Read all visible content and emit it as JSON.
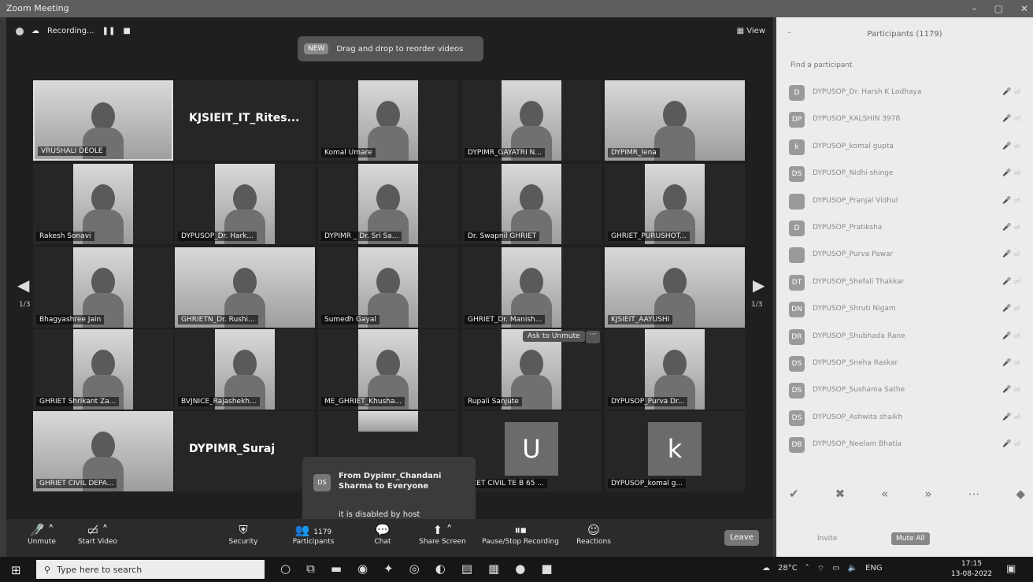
{
  "window": {
    "title": "Zoom Meeting",
    "controls": [
      "–",
      "▢",
      "✕"
    ]
  },
  "top_bar": {
    "recording_label": "Recording...",
    "view_label": "View"
  },
  "banner": {
    "badge": "NEW",
    "text": "Drag and drop to reorder videos"
  },
  "pager": {
    "left_count": "1/3",
    "right_count": "1/3"
  },
  "tiles": [
    {
      "label": "VRUSHALI DEOLE",
      "type": "wide"
    },
    {
      "label": "KJSIEIT_IT_Rites...",
      "type": "name"
    },
    {
      "label": "Komal Umare",
      "type": "narrow"
    },
    {
      "label": "DYPIMR_GAYATRI N...",
      "type": "narrow"
    },
    {
      "label": "DYPIMR_lena",
      "type": "wide"
    },
    {
      "label": "Rakesh Sonavi",
      "type": "narrow"
    },
    {
      "label": "DYPUSOP_Dr. Hark...",
      "type": "narrow"
    },
    {
      "label": "DYPIMR _ Dr. Sri Sa...",
      "type": "narrow"
    },
    {
      "label": "Dr. Swapnil GHRIET",
      "type": "narrow"
    },
    {
      "label": "GHRIET_PURUSHOT...",
      "type": "narrow"
    },
    {
      "label": "Bhagyashree Jain",
      "type": "narrow"
    },
    {
      "label": "GHRIETN_Dr. Rushi...",
      "type": "wide"
    },
    {
      "label": "Sumedh Gayal",
      "type": "narrow"
    },
    {
      "label": "GHRIET_Dr. Manish...",
      "type": "narrow"
    },
    {
      "label": "KJSIEIT_AAYUSHI",
      "type": "wide"
    },
    {
      "label": "GHRIET Shrikant Za...",
      "type": "narrow"
    },
    {
      "label": "BVJNICE_Rajashekh...",
      "type": "narrow"
    },
    {
      "label": "ME_GHRIET_Khusha...",
      "type": "narrow"
    },
    {
      "label": "Rupali Sanjute",
      "type": "narrow"
    },
    {
      "label": "DYPUSOP_Purva Dr...",
      "type": "narrow"
    },
    {
      "label": "GHRIET CIVIL DEPA...",
      "type": "wide"
    },
    {
      "label": "DYPIMR_Suraj",
      "type": "name"
    },
    {
      "label": "",
      "type": "partial"
    },
    {
      "label": "TCET CIVIL TE B 65 ...",
      "type": "avatar",
      "letter": "U"
    },
    {
      "label": "DYPUSOP_komal g...",
      "type": "avatar",
      "letter": "k"
    }
  ],
  "ask_to_unmute": {
    "label": "Ask to Unmute",
    "more": "···"
  },
  "chat_popup": {
    "avatar": "DS",
    "from": "From Dypimr_Chandani Sharma to Everyone",
    "message": "it is disabled by host"
  },
  "toolbar": {
    "unmute": "Unmute",
    "start_video": "Start Video",
    "security": "Security",
    "participants": "Participants",
    "participants_count": "1179",
    "chat": "Chat",
    "share_screen": "Share Screen",
    "pause_stop_recording": "Pause/Stop Recording",
    "reactions": "Reactions",
    "leave": "Leave"
  },
  "panel": {
    "title": "Participants (1179)",
    "search_placeholder": "Find a participant",
    "participants": [
      {
        "initials": "D",
        "name": "DYPUSOP_Dr. Harsh K Lodhaya"
      },
      {
        "initials": "DP",
        "name": "DYPUSOP_KALSHIN 3978"
      },
      {
        "initials": "k",
        "name": "DYPUSOP_komal gupta"
      },
      {
        "initials": "DS",
        "name": "DYPUSOP_Nidhi shinge"
      },
      {
        "initials": "",
        "name": "DYPUSOP_Pranjal Vidhul"
      },
      {
        "initials": "D",
        "name": "DYPUSOP_Pratiksha"
      },
      {
        "initials": "",
        "name": "DYPUSOP_Purva Pawar"
      },
      {
        "initials": "DT",
        "name": "DYPUSOP_Shefali Thakkar"
      },
      {
        "initials": "DN",
        "name": "DYPUSOP_Shruti Nigam"
      },
      {
        "initials": "DR",
        "name": "DYPUSOP_Shubhada Rane"
      },
      {
        "initials": "DS",
        "name": "DYPUSOP_Sneha Raskar"
      },
      {
        "initials": "DS",
        "name": "DYPUSOP_Sushama Sathe"
      },
      {
        "initials": "DS",
        "name": "DYPUSOP_Ashwita shaikh"
      },
      {
        "initials": "DB",
        "name": "DYPUSOP_Neelam Bhatia"
      }
    ],
    "invite": "Invite",
    "mute_all": "Mute All"
  },
  "taskbar": {
    "search_placeholder": "Type here to search",
    "weather": "28°C",
    "language": "ENG",
    "time": "17:15",
    "date": "13-08-2022"
  }
}
